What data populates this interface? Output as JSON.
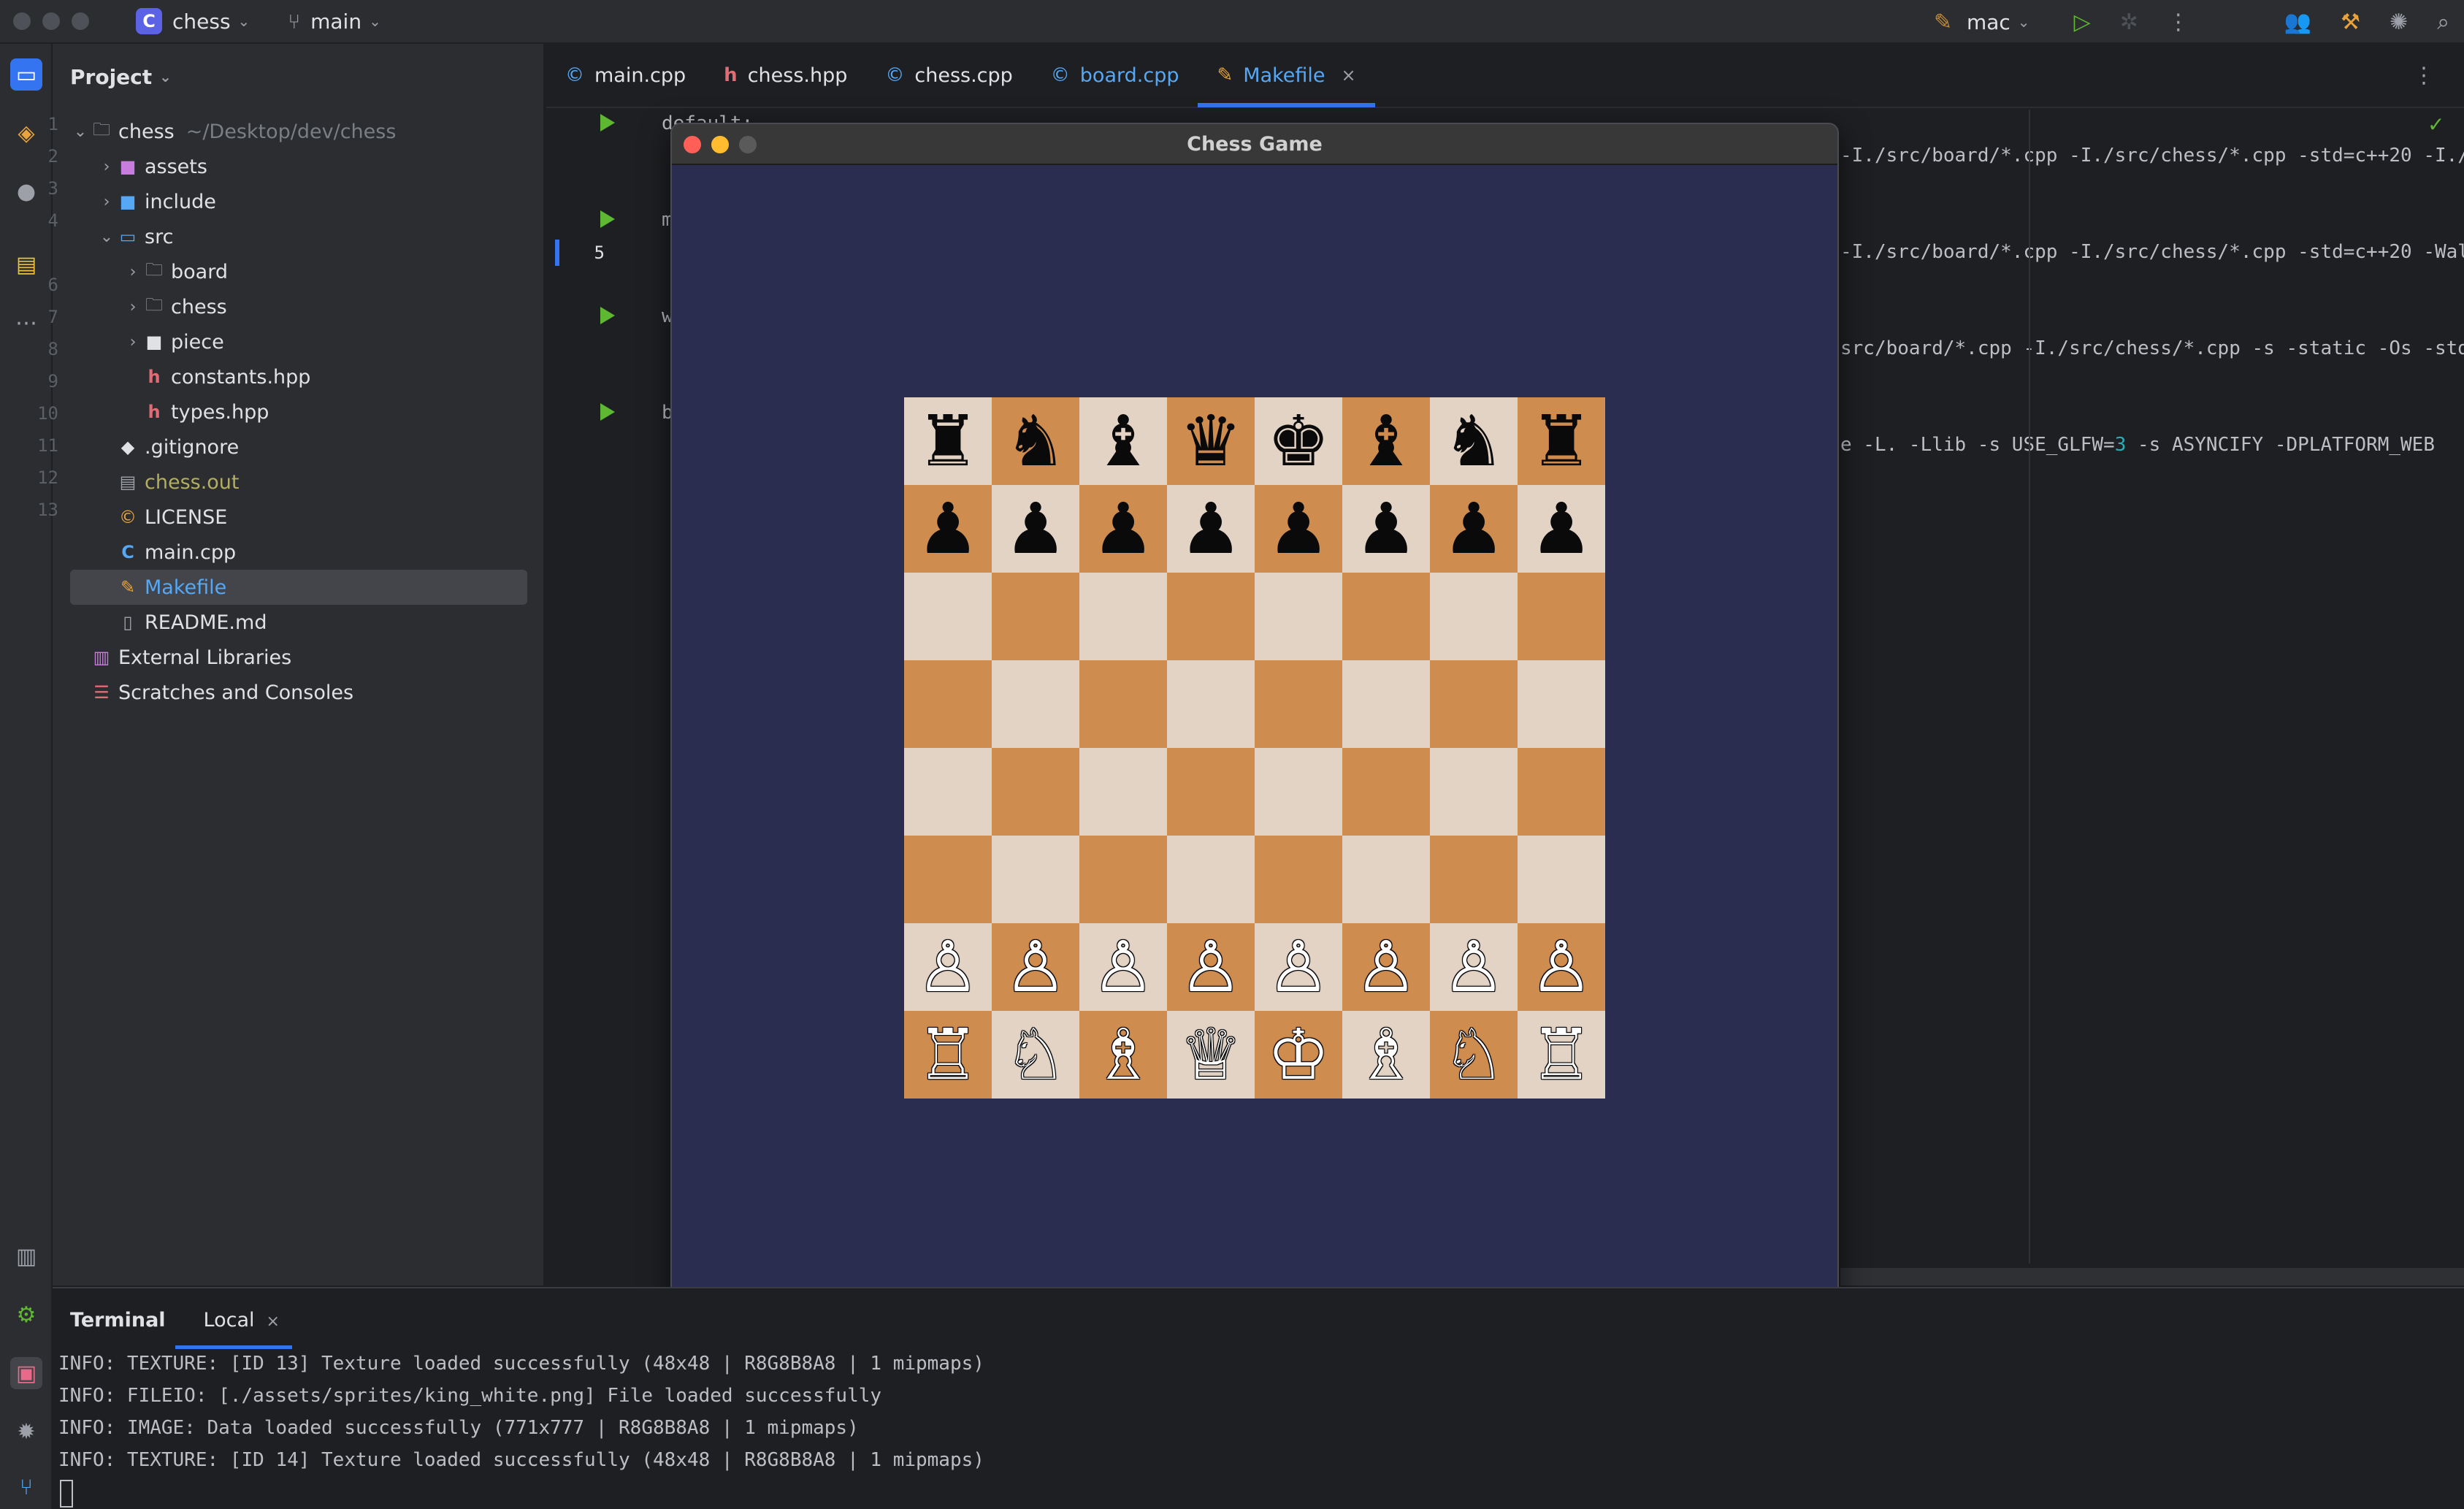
{
  "titlebar": {
    "project_badge": "C",
    "project_name": "chess",
    "branch": "main",
    "run_config": "mac"
  },
  "project_panel": {
    "header": "Project",
    "root_name": "chess",
    "root_path": "~/Desktop/dev/chess",
    "items": {
      "assets": "assets",
      "include": "include",
      "src": "src",
      "board": "board",
      "chess": "chess",
      "piece": "piece",
      "constants": "constants.hpp",
      "types": "types.hpp",
      "gitignore": ".gitignore",
      "chess_out": "chess.out",
      "license": "LICENSE",
      "main_cpp": "main.cpp",
      "makefile": "Makefile",
      "readme": "README.md",
      "ext_libs": "External Libraries",
      "scratches": "Scratches and Consoles"
    }
  },
  "editor": {
    "tabs": [
      "main.cpp",
      "chess.hpp",
      "chess.cpp",
      "board.cpp",
      "Makefile"
    ],
    "line_numbers": [
      "1",
      "2",
      "3",
      "4",
      "5",
      "6",
      "7",
      "8",
      "9",
      "10",
      "11",
      "12",
      "13"
    ],
    "code_fragments": {
      "l1": "-I./src/board/*.cpp -I./src/chess/*.cpp -std=c++20 -I./",
      "l4": "-I./src/board/*.cpp -I./src/chess/*.cpp -std=c++20 -Wal",
      "l7": "src/board/*.cpp -I./src/chess/*.cpp -s -static -Os -std",
      "l10_a": "e -L. -Llib -s USE_GLFW=",
      "l10_num": "3",
      "l10_b": " -s ASYNCIFY -DPLATFORM_WEB",
      "gutter_1": "default:",
      "gutter_4": "m",
      "gutter_7": "w",
      "gutter_10": "b"
    }
  },
  "game_window": {
    "title": "Chess Game",
    "board": [
      [
        "♜",
        "♞",
        "♝",
        "♛",
        "♚",
        "♝",
        "♞",
        "♜"
      ],
      [
        "♟",
        "♟",
        "♟",
        "♟",
        "♟",
        "♟",
        "♟",
        "♟"
      ],
      [
        "",
        "",
        "",
        "",
        "",
        "",
        "",
        ""
      ],
      [
        "",
        "",
        "",
        "",
        "",
        "",
        "",
        ""
      ],
      [
        "",
        "",
        "",
        "",
        "",
        "",
        "",
        ""
      ],
      [
        "",
        "",
        "",
        "",
        "",
        "",
        "",
        ""
      ],
      [
        "♙",
        "♙",
        "♙",
        "♙",
        "♙",
        "♙",
        "♙",
        "♙"
      ],
      [
        "♖",
        "♘",
        "♗",
        "♕",
        "♔",
        "♗",
        "♘",
        "♖"
      ]
    ]
  },
  "terminal": {
    "tab_terminal": "Terminal",
    "tab_local": "Local",
    "lines": [
      "INFO: TEXTURE: [ID 13] Texture loaded successfully (48x48 | R8G8B8A8 | 1 mipmaps)",
      "INFO: FILEIO: [./assets/sprites/king_white.png] File loaded successfully",
      "INFO: IMAGE: Data loaded successfully (771x777 | R8G8B8A8 | 1 mipmaps)",
      "INFO: TEXTURE: [ID 14] Texture loaded successfully (48x48 | R8G8B8A8 | 1 mipmaps)"
    ]
  },
  "colors": {
    "accent": "#3574f0",
    "board_light": "#e3d3c5",
    "board_dark": "#cf8c4f",
    "game_bg": "#2b2d50"
  }
}
